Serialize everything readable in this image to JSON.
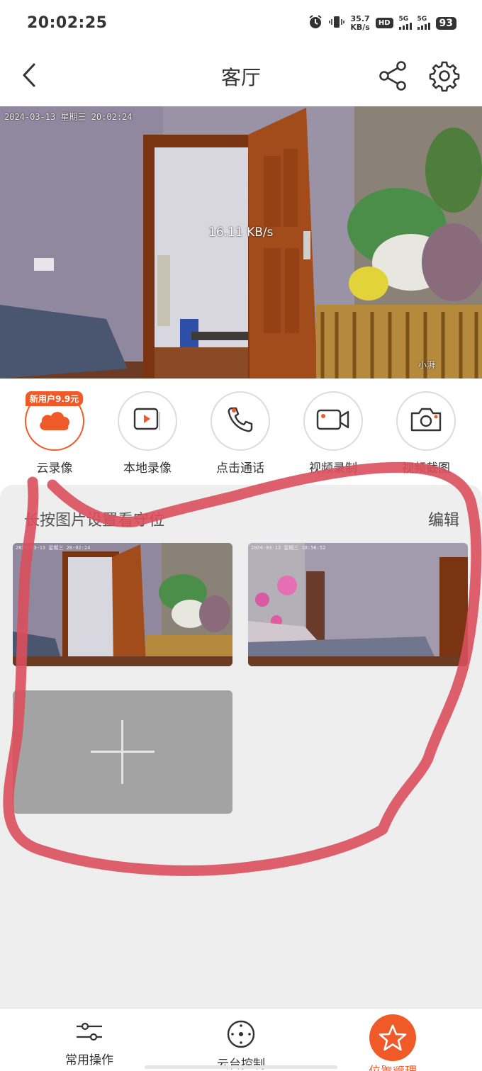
{
  "status_bar": {
    "time": "20:02:25",
    "net_speed_value": "35.7",
    "net_speed_unit": "KB/s",
    "hd_label": "HD",
    "sim1_label": "5G",
    "sim2_label": "5G",
    "battery": "93",
    "icons": [
      "alarm-icon",
      "vibrate-icon",
      "hd-icon",
      "signal-icon",
      "signal-icon",
      "battery-icon"
    ]
  },
  "header": {
    "title": "客厅",
    "back_icon": "chevron-left-icon",
    "share_icon": "share-icon",
    "settings_icon": "gear-icon"
  },
  "video": {
    "timestamp": "2024-03-13 星期三 20:02:24",
    "bitrate": "16.11 KB/s",
    "watermark": "小湃"
  },
  "actions": {
    "badge": "新用户9.9元",
    "items": [
      {
        "label": "云录像",
        "icon": "cloud-icon",
        "active": true
      },
      {
        "label": "本地录像",
        "icon": "play-icon",
        "active": false
      },
      {
        "label": "点击通话",
        "icon": "phone-icon",
        "active": false
      },
      {
        "label": "视频录制",
        "icon": "video-camera-icon",
        "active": false
      },
      {
        "label": "视频截图",
        "icon": "camera-icon",
        "active": false
      }
    ]
  },
  "presets": {
    "title": "长按图片设置看守位",
    "edit": "编辑",
    "thumb1_ts": "2024-03-13 星期三 20:02:24",
    "thumb2_ts": "2024-03-13 星期三 18:56:52",
    "add_icon": "plus-icon"
  },
  "bottom_nav": {
    "items": [
      {
        "label": "常用操作",
        "icon": "sliders-icon",
        "active": false
      },
      {
        "label": "云台控制",
        "icon": "dpad-icon",
        "active": false
      },
      {
        "label": "位置管理",
        "icon": "star-icon",
        "active": true
      }
    ]
  },
  "colors": {
    "accent": "#f05a28",
    "panel_bg": "#eeeeee",
    "annotation": "#d94f5c"
  }
}
